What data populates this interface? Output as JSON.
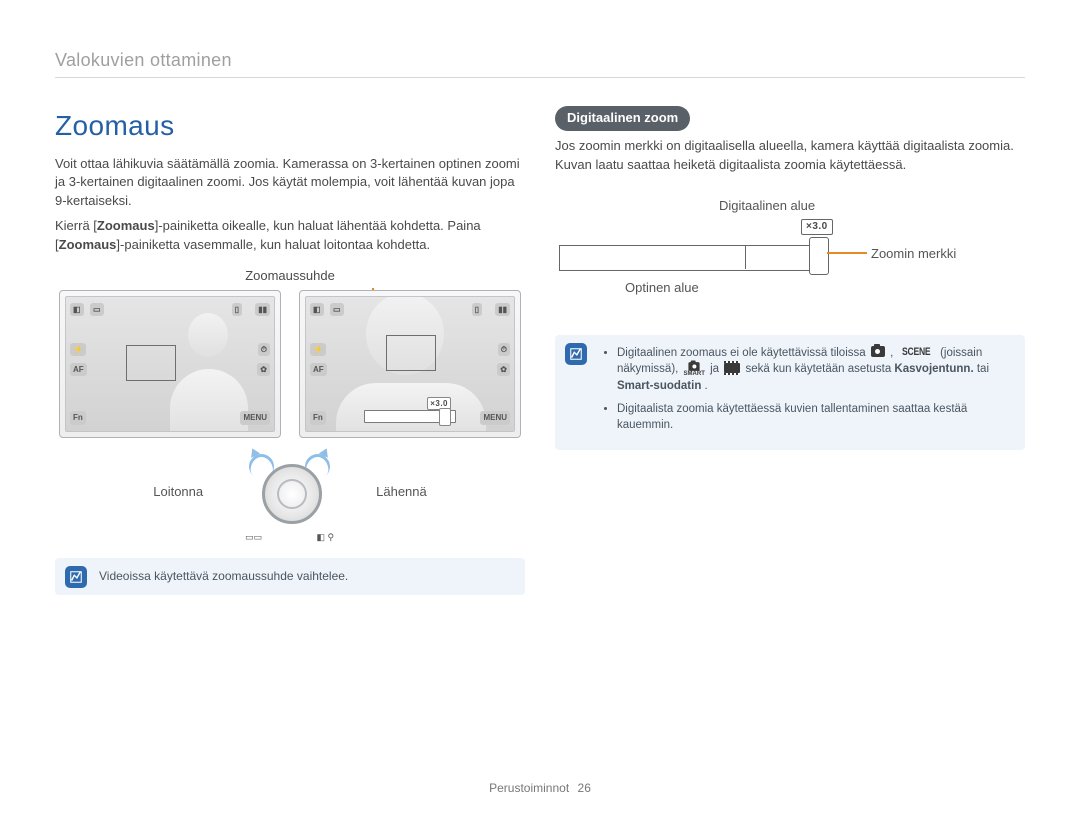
{
  "breadcrumb": "Valokuvien ottaminen",
  "left": {
    "heading": "Zoomaus",
    "para1": "Voit ottaa lähikuvia säätämällä zoomia. Kamerassa on 3-kertainen optinen zoomi ja 3-kertainen digitaalinen zoomi. Jos käytät molempia, voit lähentää kuvan jopa 9-kertaiseksi.",
    "para2_pre": "Kierrä [",
    "para2_btn1": "Zoomaus",
    "para2_mid": "]-painiketta oikealle, kun haluat lähentää kohdetta. Paina [",
    "para2_btn2": "Zoomaus",
    "para2_post": "]-painiketta vasemmalle, kun haluat loitontaa kohdetta.",
    "zoomratio_label": "Zoomaussuhde",
    "dial_zoom_out": "Loitonna",
    "dial_zoom_in": "Lähennä",
    "note": "Videoissa käytettävä zoomaussuhde vaihtelee.",
    "zoom_tag_left": "",
    "zoom_tag_right": "×3.0"
  },
  "right": {
    "pill": "Digitaalinen zoom",
    "para": "Jos zoomin merkki on digitaalisella alueella, kamera käyttää digitaalista zoomia. Kuvan laatu saattaa heiketä digitaalista zoomia käytettäessä.",
    "diagram": {
      "digital_label": "Digitaalinen alue",
      "optical_label": "Optinen alue",
      "marker_label": "Zoomin merkki",
      "tag": "×3.0"
    },
    "note": {
      "bullet1_pre": "Digitaalinen zoomaus ei ole käytettävissä tiloissa ",
      "bullet1_mid1": " , ",
      "bullet1_mid2": " (joissain näkymissä), ",
      "bullet1_mid3": " ja ",
      "bullet1_mid4": " sekä kun käytetään asetusta ",
      "bullet1_b1": "Kasvojentunn.",
      "bullet1_mid5": " tai ",
      "bullet1_b2": "Smart-suodatin",
      "bullet1_post": ".",
      "bullet2": "Digitaalista zoomia käytettäessä kuvien tallentaminen saattaa kestää kauemmin.",
      "scene_text": "SCENE",
      "smart_text": "SMART"
    }
  },
  "footer": {
    "label": "Perustoiminnot",
    "page": "26"
  }
}
